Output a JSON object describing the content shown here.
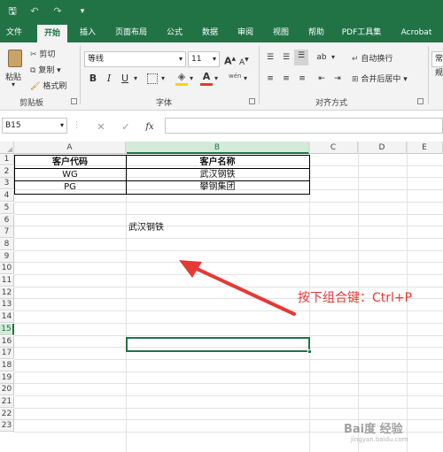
{
  "quick_access": {
    "save": "🖫",
    "undo": "↶",
    "redo": "↷",
    "customize": "▾"
  },
  "tabs": [
    "文件",
    "开始",
    "插入",
    "页面布局",
    "公式",
    "数据",
    "审阅",
    "视图",
    "帮助",
    "PDF工具集",
    "Acrobat"
  ],
  "active_tab": "开始",
  "ribbon": {
    "clipboard": {
      "paste": "粘贴",
      "cut": "剪切",
      "copy": "复制 ▾",
      "format_painter": "格式刷",
      "group_label": "剪贴板"
    },
    "font": {
      "font_name": "等线",
      "font_size": "11",
      "grow": "A",
      "shrink": "A",
      "bold": "B",
      "italic": "I",
      "underline": "U",
      "group_label": "字体",
      "wen": "wén"
    },
    "alignment": {
      "wrap_text": "自动换行",
      "merge_center": "合并后居中 ▾",
      "group_label": "对齐方式"
    },
    "number": {
      "format": "常规"
    }
  },
  "formula_bar": {
    "name_box": "B15",
    "cancel": "✕",
    "enter": "✓",
    "fx": "fx",
    "formula": ""
  },
  "columns": [
    "A",
    "B",
    "C",
    "D",
    "E"
  ],
  "rows": [
    "1",
    "2",
    "3",
    "4",
    "5",
    "6",
    "7",
    "8",
    "9",
    "10",
    "11",
    "12",
    "13",
    "14",
    "15",
    "16",
    "17",
    "18",
    "19",
    "20",
    "21",
    "22",
    "23"
  ],
  "cells": {
    "A1": "客户代码",
    "B1": "客户名称",
    "A2": "WG",
    "B2": "武汉钢铁",
    "A3": "PG",
    "B3": "攀钢集团",
    "B6": "武汉钢铁"
  },
  "annotation": {
    "text": "按下组合键：Ctrl+P",
    "color": "#e53935"
  },
  "watermark": {
    "text": "Bai度 经验",
    "sub": "jingyan.baidu.com"
  },
  "colors": {
    "accent": "#217346",
    "selected_header": "#d2ebd9"
  }
}
